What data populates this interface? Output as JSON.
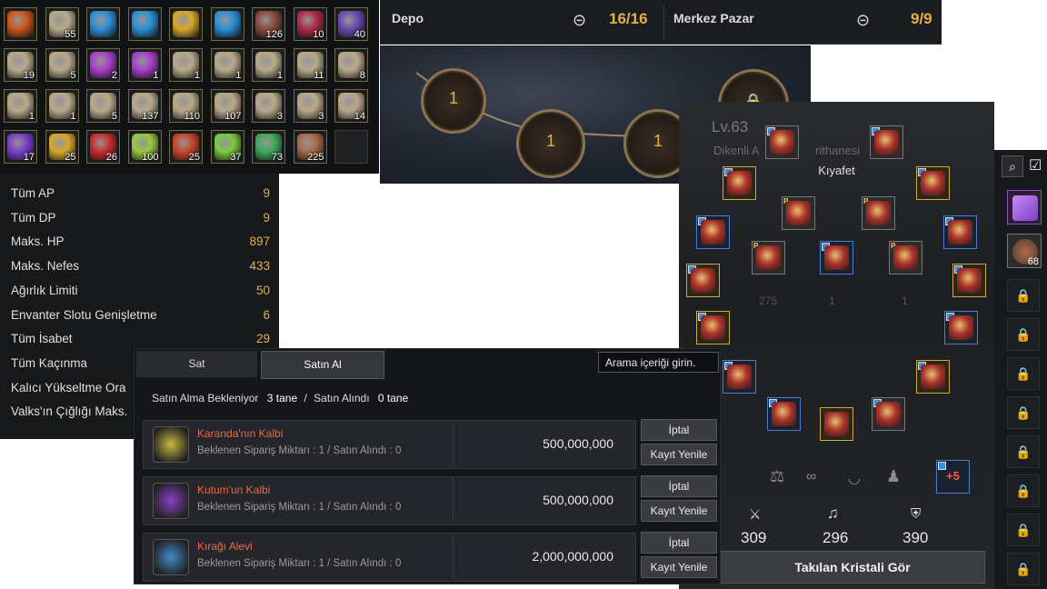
{
  "inventory": {
    "slots": [
      {
        "icon": "compass-orb-icon",
        "color": "#c9561c",
        "count": ""
      },
      {
        "icon": "chest-icon",
        "color": "#b9a98a",
        "count": "55"
      },
      {
        "icon": "blue-gem-icon",
        "color": "#2b8fd6",
        "count": ""
      },
      {
        "icon": "blue-gem-icon",
        "color": "#2b8fd6",
        "count": ""
      },
      {
        "icon": "gold-gem-icon",
        "color": "#d6a82b",
        "count": ""
      },
      {
        "icon": "blue-gem-icon",
        "color": "#2b8fd6",
        "count": ""
      },
      {
        "icon": "hide-material-icon",
        "color": "#8a4a3a",
        "count": "126"
      },
      {
        "icon": "red-crystal-icon",
        "color": "#b02a4a",
        "count": "10"
      },
      {
        "icon": "purple-crystal-icon",
        "color": "#6a4ab0",
        "count": "40"
      },
      {
        "icon": "chest-icon",
        "color": "#b9a98a",
        "count": "19"
      },
      {
        "icon": "chest-icon",
        "color": "#b9a98a",
        "count": "5"
      },
      {
        "icon": "purple-pouch-icon",
        "color": "#a63fc9",
        "count": "2"
      },
      {
        "icon": "purple-pouch-icon",
        "color": "#a63fc9",
        "count": "1"
      },
      {
        "icon": "chest-icon",
        "color": "#b9a98a",
        "count": "1"
      },
      {
        "icon": "chest-icon",
        "color": "#b9a98a",
        "count": "1"
      },
      {
        "icon": "chest-icon",
        "color": "#b9a98a",
        "count": "1"
      },
      {
        "icon": "chest-icon",
        "color": "#b9a98a",
        "count": "11"
      },
      {
        "icon": "chest-icon",
        "color": "#b9a98a",
        "count": "8"
      },
      {
        "icon": "chest-icon",
        "color": "#b9a98a",
        "count": "1"
      },
      {
        "icon": "chest-icon",
        "color": "#b9a98a",
        "count": "1"
      },
      {
        "icon": "chest-icon",
        "color": "#b9a98a",
        "count": "5"
      },
      {
        "icon": "chest-icon",
        "color": "#b9a98a",
        "count": "137"
      },
      {
        "icon": "chest-icon",
        "color": "#b9a98a",
        "count": "110"
      },
      {
        "icon": "chest-icon",
        "color": "#b9a98a",
        "count": "107"
      },
      {
        "icon": "chest-icon",
        "color": "#b9a98a",
        "count": "3"
      },
      {
        "icon": "chest-icon",
        "color": "#b9a98a",
        "count": "3"
      },
      {
        "icon": "chest-icon",
        "color": "#b9a98a",
        "count": "14"
      },
      {
        "icon": "purple-stone-icon",
        "color": "#7a3fc9",
        "count": "17"
      },
      {
        "icon": "golden-feather-icon",
        "color": "#d6a82b",
        "count": "25"
      },
      {
        "icon": "red-orb-icon",
        "color": "#c92b2b",
        "count": "26"
      },
      {
        "icon": "green-knot-icon",
        "color": "#9ac93f",
        "count": "100"
      },
      {
        "icon": "red-crystal-icon",
        "color": "#c9452b",
        "count": "25"
      },
      {
        "icon": "green-orb-icon",
        "color": "#7ac93f",
        "count": "37"
      },
      {
        "icon": "green-herb-icon",
        "color": "#3fa85a",
        "count": "73"
      },
      {
        "icon": "ore-chunk-icon",
        "color": "#a86a4a",
        "count": "225"
      },
      {
        "icon": "",
        "color": "",
        "count": ""
      }
    ]
  },
  "stats": [
    {
      "label": "Tüm AP",
      "value": "9"
    },
    {
      "label": "Tüm DP",
      "value": "9"
    },
    {
      "label": "Maks. HP",
      "value": "897"
    },
    {
      "label": "Maks. Nefes",
      "value": "433"
    },
    {
      "label": "Ağırlık Limiti",
      "value": "50"
    },
    {
      "label": "Envanter Slotu Genişletme",
      "value": "6"
    },
    {
      "label": "Tüm İsabet",
      "value": "29"
    },
    {
      "label": "Tüm Kaçınma",
      "value": ""
    },
    {
      "label": "Kalıcı Yükseltme Ora",
      "value": ""
    },
    {
      "label": "Valks'ın Çığlığı Maks.",
      "value": ""
    }
  ],
  "storage": {
    "depo_label": "Depo",
    "depo_count": "16/16",
    "pazar_label": "Merkez Pazar",
    "pazar_count": "9/9"
  },
  "scene": {
    "medals": [
      "1",
      "1",
      "1"
    ]
  },
  "market": {
    "tab_sell": "Sat",
    "tab_buy": "Satın Al",
    "search_placeholder": "Arama içeriği girin.",
    "pending_label": "Satın Alma Bekleniyor",
    "pending_count": "3 tane",
    "separator": "/",
    "bought_label": "Satın Alındı",
    "bought_count": "0 tane",
    "orders": [
      {
        "name": "Karanda'nın Kalbi",
        "sub": "Beklenen Sipariş Miktarı : 1 / Satın Alındı : 0",
        "price": "500,000,000",
        "cancel": "İptal",
        "renew": "Kayıt Yenile",
        "color": "#c9b83f"
      },
      {
        "name": "Kutum'un Kalbi",
        "sub": "Beklenen Sipariş Miktarı : 1 / Satın Alındı : 0",
        "price": "500,000,000",
        "cancel": "İptal",
        "renew": "Kayıt Yenile",
        "color": "#8a3fc9"
      },
      {
        "name": "Kırağı Alevi",
        "sub": "Beklenen Sipariş Miktarı : 1 / Satın Alındı : 0",
        "price": "2,000,000,000",
        "cancel": "İptal",
        "renew": "Kayıt Yenile",
        "color": "#3f8ac9"
      }
    ]
  },
  "equipment": {
    "level": "Lv.63",
    "guild_text": "Dikenli A",
    "guild_suffix": "rithanesi",
    "kiyafet_label": "Kıyafet",
    "attack": "309",
    "awaken": "296",
    "defense": "390",
    "view_crystal_button": "Takılan Kristali Gör",
    "enhance_label": "+5",
    "bg_numbers": [
      "275",
      "1",
      "1"
    ]
  },
  "sidebar": {
    "bag_count": "68"
  }
}
